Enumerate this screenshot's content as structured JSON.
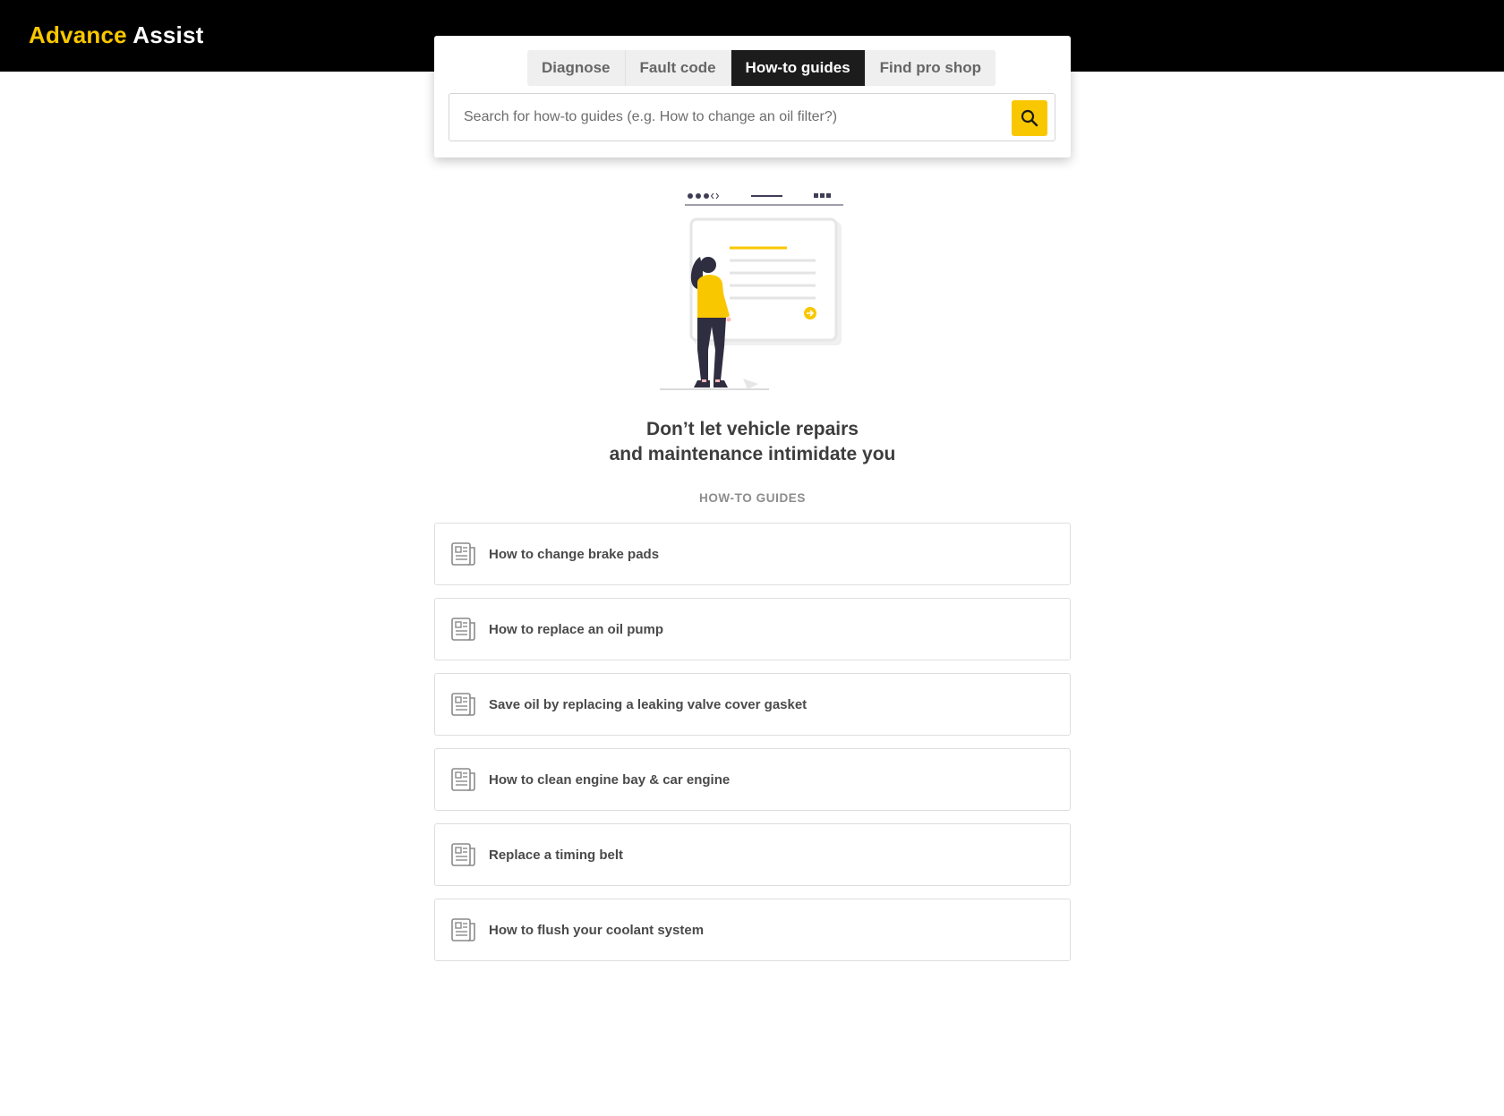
{
  "header": {
    "brand_part1": "Advance",
    "brand_part2": "Assist",
    "brand_color": "#f9c700",
    "background": "#000000"
  },
  "tabs": [
    {
      "label": "Diagnose",
      "active": false
    },
    {
      "label": "Fault code",
      "active": false
    },
    {
      "label": "How-to guides",
      "active": true
    },
    {
      "label": "Find pro shop",
      "active": false
    }
  ],
  "search": {
    "placeholder": "Search for how-to guides (e.g. How to change an oil filter?)",
    "value": "",
    "button_icon": "search-icon",
    "button_color": "#f9c700"
  },
  "hero": {
    "headline_line1": "Don’t let vehicle repairs",
    "headline_line2": "and maintenance intimidate you"
  },
  "guides_section": {
    "label": "HOW-TO GUIDES",
    "item_icon": "article-icon",
    "items": [
      {
        "label": "How to change brake pads"
      },
      {
        "label": "How to replace an oil pump"
      },
      {
        "label": "Save oil by replacing a leaking valve cover gasket"
      },
      {
        "label": "How to clean engine bay & car engine"
      },
      {
        "label": "Replace a timing belt"
      },
      {
        "label": "How to flush your coolant system"
      }
    ]
  }
}
